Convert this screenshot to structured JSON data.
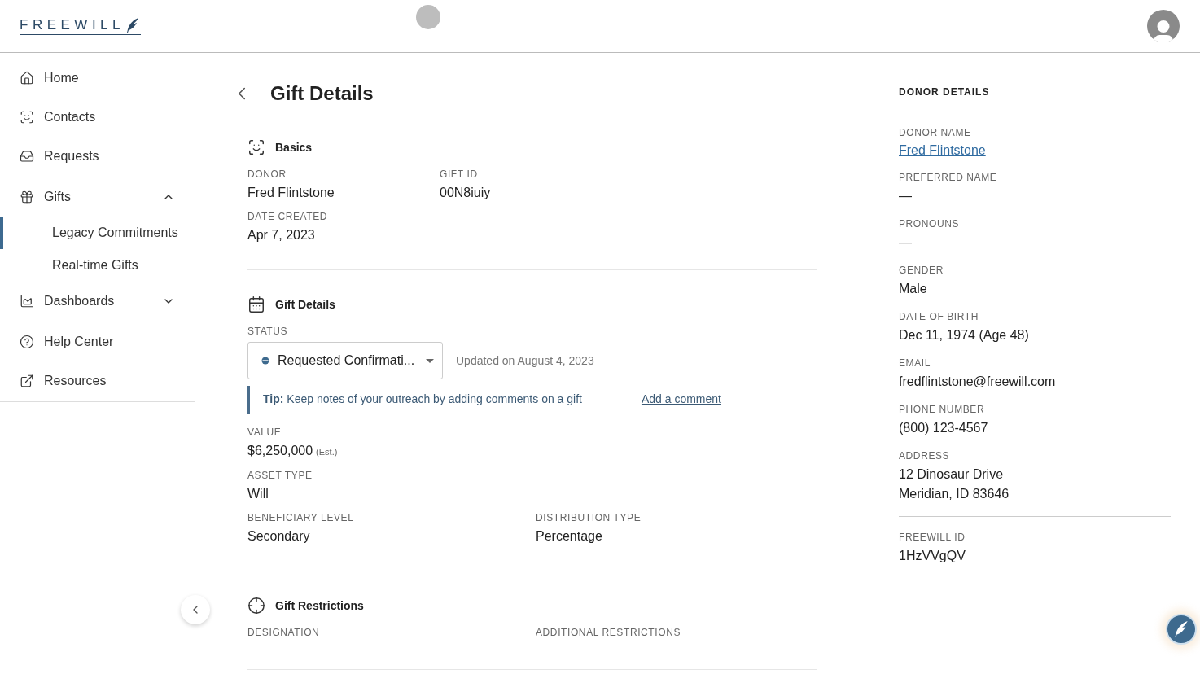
{
  "header": {
    "logo": "FREEWILL"
  },
  "sidebar": {
    "groups": [
      [
        {
          "kind": "link",
          "label": "Home"
        },
        {
          "kind": "link",
          "label": "Contacts"
        },
        {
          "kind": "link",
          "label": "Requests"
        }
      ],
      [
        {
          "kind": "group",
          "label": "Gifts",
          "expanded": true,
          "children": [
            {
              "label": "Legacy Commitments",
              "selected": true
            },
            {
              "label": "Real-time Gifts",
              "selected": false
            }
          ]
        },
        {
          "kind": "group",
          "label": "Dashboards",
          "expanded": false
        }
      ],
      [
        {
          "kind": "link",
          "label": "Help Center"
        },
        {
          "kind": "link",
          "label": "Resources"
        }
      ]
    ]
  },
  "page": {
    "title": "Gift Details",
    "sections": [
      {
        "title": "Basics",
        "items": [
          {
            "kind": "fields",
            "fields": [
              {
                "label": "DONOR",
                "value": "Fred Flintstone"
              },
              {
                "label": "GIFT ID",
                "value": "00N8iuiy"
              }
            ]
          },
          {
            "kind": "fields",
            "fields": [
              {
                "label": "DATE CREATED",
                "value": "Apr 7, 2023"
              }
            ]
          }
        ]
      },
      {
        "title": "Gift Details",
        "items": [
          {
            "kind": "status",
            "label": "STATUS",
            "value": "Requested Confirmati...",
            "updated": "Updated on August 4, 2023"
          },
          {
            "kind": "tip",
            "lead": "Tip:",
            "text": "Keep notes of your outreach by adding comments on a gift",
            "link": "Add a comment"
          },
          {
            "kind": "fields",
            "fields": [
              {
                "label": "VALUE",
                "value": "$6,250,000",
                "note": "(Est.)"
              }
            ]
          },
          {
            "kind": "fields",
            "fields": [
              {
                "label": "ASSET TYPE",
                "value": "Will"
              }
            ]
          },
          {
            "kind": "fields",
            "fields": [
              {
                "label": "BENEFICIARY LEVEL",
                "value": "Secondary"
              },
              {
                "label": "DISTRIBUTION TYPE",
                "value": "Percentage"
              }
            ]
          }
        ]
      },
      {
        "title": "Gift Restrictions",
        "items": [
          {
            "kind": "fields",
            "fields": [
              {
                "label": "DESIGNATION"
              },
              {
                "label": "ADDITIONAL RESTRICTIONS"
              }
            ]
          }
        ]
      }
    ]
  },
  "donor_panel": {
    "title": "DONOR DETAILS",
    "groups": [
      [
        {
          "label": "DONOR NAME",
          "kind": "link",
          "value": "Fred Flintstone"
        },
        {
          "label": "PREFERRED NAME",
          "value": "—"
        },
        {
          "label": "PRONOUNS",
          "value": "—"
        },
        {
          "label": "GENDER",
          "value": "Male"
        },
        {
          "label": "DATE OF BIRTH",
          "value": "Dec 11, 1974 (Age 48)"
        },
        {
          "label": "EMAIL",
          "value": "fredflintstone@freewill.com"
        },
        {
          "label": "PHONE NUMBER",
          "value": "(800) 123-4567"
        },
        {
          "label": "ADDRESS",
          "value": "12 Dinosaur Drive",
          "value2": "Meridian, ID 83646"
        }
      ],
      [
        {
          "label": "FREEWILL ID",
          "value": "1HzVVgQV"
        }
      ]
    ]
  }
}
